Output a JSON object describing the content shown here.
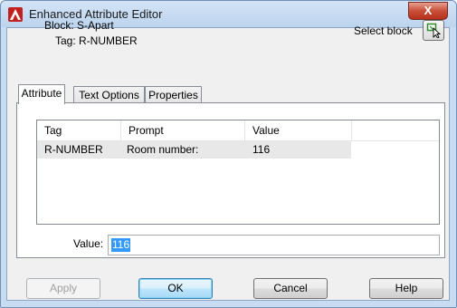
{
  "window": {
    "title": "Enhanced Attribute Editor",
    "close_glyph": "X",
    "app_icon": "autocad-a-icon",
    "close_color": "#c84f39"
  },
  "header": {
    "block_label": "Block: S-Apart",
    "tag_label": "Tag: R-NUMBER",
    "select_block_label": "Select block",
    "select_block_icon": "select-objects-cursor-icon"
  },
  "tabs": [
    {
      "label": "Attribute",
      "active": true
    },
    {
      "label": "Text Options",
      "active": false
    },
    {
      "label": "Properties",
      "active": false
    }
  ],
  "attribute_list": {
    "columns": [
      "Tag",
      "Prompt",
      "Value"
    ],
    "rows": [
      {
        "tag": "R-NUMBER",
        "prompt": "Room number:",
        "value": "116"
      }
    ]
  },
  "value_field": {
    "label": "Value:",
    "value": "116"
  },
  "buttons": {
    "apply": "Apply",
    "ok": "OK",
    "cancel": "Cancel",
    "help": "Help"
  }
}
